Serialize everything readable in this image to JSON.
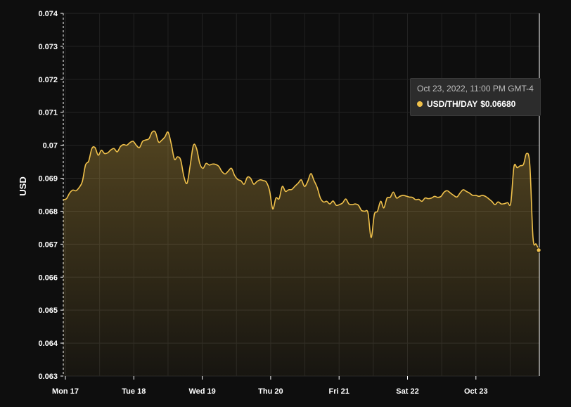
{
  "chart_data": {
    "type": "area",
    "ylabel": "USD",
    "ylim": [
      0.063,
      0.074
    ],
    "yticks": [
      "0.063",
      "0.064",
      "0.065",
      "0.066",
      "0.067",
      "0.068",
      "0.069",
      "0.07",
      "0.071",
      "0.072",
      "0.073",
      "0.074"
    ],
    "xticks": [
      "Mon 17",
      "Tue 18",
      "Wed 19",
      "Thu 20",
      "Fri 21",
      "Sat 22",
      "Oct 23"
    ],
    "grid": true,
    "line_color": "#f0c14b",
    "series": [
      {
        "values": [
          0.06835,
          0.06838,
          0.06855,
          0.06864,
          0.06862,
          0.06872,
          0.0689,
          0.0694,
          0.06952,
          0.0699,
          0.06993,
          0.0697,
          0.06985,
          0.06975,
          0.06977,
          0.06986,
          0.0699,
          0.0698,
          0.06996,
          0.07002,
          0.07,
          0.07008,
          0.07012,
          0.07,
          0.06993,
          0.07012,
          0.07016,
          0.0702,
          0.0704,
          0.0704,
          0.0701,
          0.07015,
          0.07025,
          0.0704,
          0.07005,
          0.06958,
          0.06965,
          0.06955,
          0.06905,
          0.06885,
          0.0694,
          0.07,
          0.0699,
          0.06945,
          0.0693,
          0.06945,
          0.0694,
          0.06943,
          0.06942,
          0.06936,
          0.0692,
          0.06913,
          0.06922,
          0.0693,
          0.06908,
          0.06896,
          0.06892,
          0.06882,
          0.06903,
          0.069,
          0.06882,
          0.0689,
          0.06895,
          0.06893,
          0.06888,
          0.06862,
          0.06807,
          0.0684,
          0.06838,
          0.06875,
          0.0686,
          0.06865,
          0.06866,
          0.06876,
          0.06885,
          0.06895,
          0.06875,
          0.0689,
          0.06914,
          0.06893,
          0.06872,
          0.0684,
          0.06828,
          0.0683,
          0.06822,
          0.06831,
          0.06818,
          0.0682,
          0.06825,
          0.06837,
          0.06822,
          0.0682,
          0.06822,
          0.06818,
          0.06802,
          0.068,
          0.06795,
          0.0672,
          0.0679,
          0.068,
          0.0683,
          0.0681,
          0.0684,
          0.06842,
          0.06858,
          0.0684,
          0.06845,
          0.06848,
          0.06846,
          0.06843,
          0.06842,
          0.06835,
          0.06836,
          0.0683,
          0.0684,
          0.06838,
          0.0684,
          0.06845,
          0.06842,
          0.06845,
          0.06858,
          0.06862,
          0.06855,
          0.06848,
          0.06843,
          0.06855,
          0.06865,
          0.0686,
          0.06855,
          0.06848,
          0.06848,
          0.06845,
          0.06848,
          0.06845,
          0.06838,
          0.0683,
          0.0682,
          0.06828,
          0.06822,
          0.06823,
          0.06826,
          0.06825,
          0.06935,
          0.06932,
          0.06938,
          0.06942,
          0.06975,
          0.0694,
          0.0672,
          0.067,
          0.06682
        ]
      }
    ],
    "tooltip": {
      "date": "Oct 23, 2022, 11:00 PM GMT-4",
      "series": "USD/TH/DAY",
      "value": "$0.06680"
    }
  }
}
